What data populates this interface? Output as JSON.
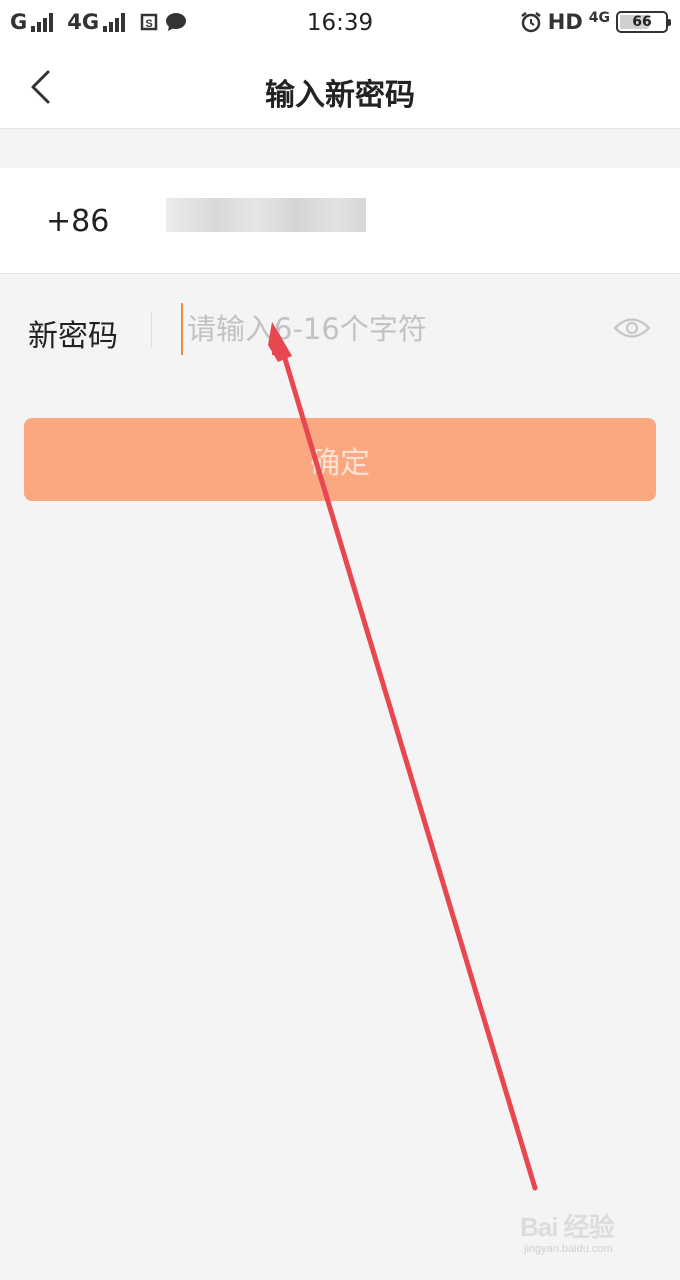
{
  "status_bar": {
    "carrier1": "G",
    "carrier2": "4G",
    "time": "16:39",
    "hd": "HD",
    "net": "4G",
    "battery": "66",
    "battery_level": 0.66
  },
  "nav": {
    "title": "输入新密码",
    "back_icon": "chevron-left-icon"
  },
  "phone": {
    "country_code": "+86"
  },
  "password": {
    "label": "新密码",
    "placeholder": "请输入6-16个字符",
    "value": "",
    "toggle_icon": "eye-icon"
  },
  "confirm": {
    "label": "确定"
  },
  "watermark": {
    "main": "Bai 经验",
    "sub": "jingyan.baidu.com"
  },
  "colors": {
    "accent": "#fba780",
    "cursor": "#f08a4b",
    "annotation_arrow": "#e8474f"
  }
}
